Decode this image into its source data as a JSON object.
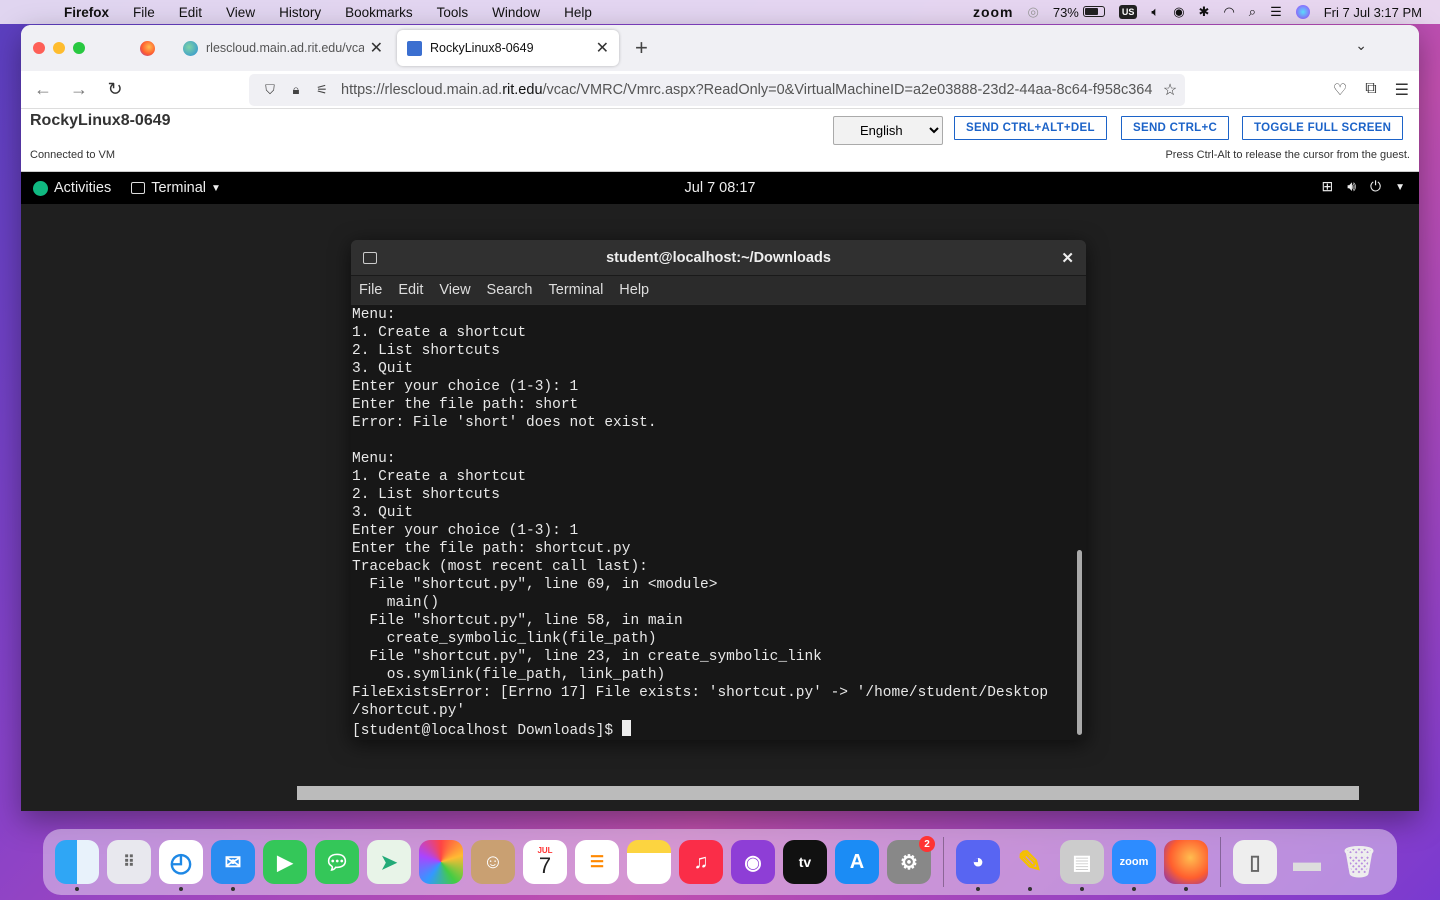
{
  "menubar": {
    "app": "Firefox",
    "items": [
      "File",
      "Edit",
      "View",
      "History",
      "Bookmarks",
      "Tools",
      "Window",
      "Help"
    ],
    "zoom": "zoom",
    "battery": "73%",
    "input_source": "US",
    "datetime": "Fri 7 Jul  3:17 PM"
  },
  "browser": {
    "tabs": [
      {
        "title": "rlescloud.main.ad.rit.edu/vcac/L"
      },
      {
        "title": "RockyLinux8-0649"
      }
    ],
    "url_host": "https://rlescloud.main.ad.",
    "url_domain": "rit.edu",
    "url_path": "/vcac/VMRC/Vmrc.aspx?ReadOnly=0&VirtualMachineID=a2e03888-23d2-44aa-8c64-f958c364"
  },
  "vmrc": {
    "title": "RockyLinux8-0649",
    "status": "Connected to VM",
    "language": "English",
    "btn_ctrl_alt_del": "SEND CTRL+ALT+DEL",
    "btn_ctrl_c": "SEND CTRL+C",
    "btn_fullscreen": "TOGGLE FULL SCREEN",
    "hint": "Press Ctrl-Alt to release the cursor from the guest."
  },
  "gnome": {
    "activities": "Activities",
    "app": "Terminal",
    "clock": "Jul 7  08:17"
  },
  "terminal": {
    "title": "student@localhost:~/Downloads",
    "menu": [
      "File",
      "Edit",
      "View",
      "Search",
      "Terminal",
      "Help"
    ],
    "output": "Menu:\n1. Create a shortcut\n2. List shortcuts\n3. Quit\nEnter your choice (1-3): 1\nEnter the file path: short\nError: File 'short' does not exist.\n\nMenu:\n1. Create a shortcut\n2. List shortcuts\n3. Quit\nEnter your choice (1-3): 1\nEnter the file path: shortcut.py\nTraceback (most recent call last):\n  File \"shortcut.py\", line 69, in <module>\n    main()\n  File \"shortcut.py\", line 58, in main\n    create_symbolic_link(file_path)\n  File \"shortcut.py\", line 23, in create_symbolic_link\n    os.symlink(file_path, link_path)\nFileExistsError: [Errno 17] File exists: 'shortcut.py' -> '/home/student/Desktop\n/shortcut.py'",
    "prompt": "[student@localhost Downloads]$ "
  },
  "dock": {
    "calendar_month": "JUL",
    "calendar_day": "7",
    "settings_badge": "2",
    "tv_label": "tv",
    "zoom_label": "zoom"
  }
}
